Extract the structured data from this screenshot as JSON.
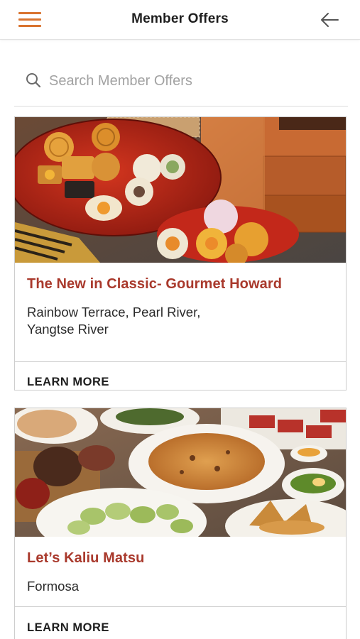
{
  "header": {
    "title": "Member Offers",
    "menu_icon": "hamburger-menu-icon",
    "back_icon": "arrow-left-icon"
  },
  "search": {
    "placeholder": "Search Member Offers",
    "value": "",
    "icon": "search-icon"
  },
  "offers": [
    {
      "title": "The New in Classic- Gourmet Howard",
      "location_line1": "Rainbow Terrace, Pearl River,",
      "location_line2": "Yangtse River",
      "cta": "LEARN MORE"
    },
    {
      "title": "Let’s Kaliu Matsu",
      "location_line1": "Formosa",
      "cta": "LEARN MORE"
    }
  ],
  "colors": {
    "accent": "#d9732f",
    "title_red": "#a9392c",
    "border": "#cdcdcd"
  }
}
